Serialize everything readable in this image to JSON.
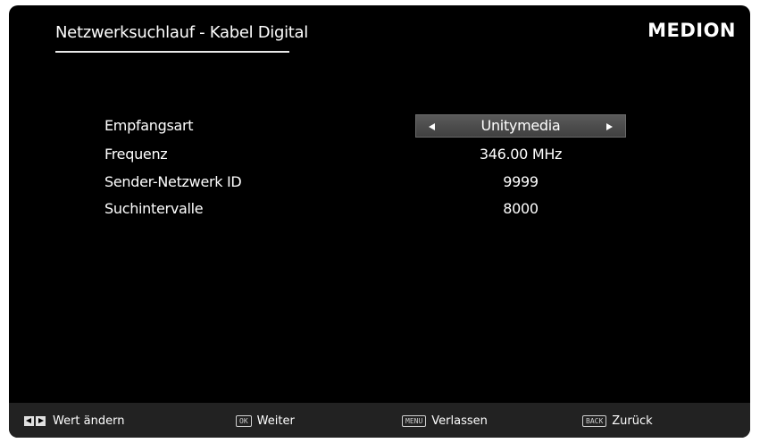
{
  "header": {
    "title": "Netzwerksuchlauf - Kabel Digital",
    "brand": "MEDION"
  },
  "settings": [
    {
      "label": "Empfangsart",
      "value": "Unitymedia"
    },
    {
      "label": "Frequenz",
      "value": "346.00 MHz"
    },
    {
      "label": "Sender-Netzwerk ID",
      "value": "9999"
    },
    {
      "label": "Suchintervalle",
      "value": "8000"
    }
  ],
  "footer": {
    "change": {
      "keys_icon": "left-right-arrow-keys-icon",
      "label": "Wert ändern"
    },
    "next": {
      "key": "OK",
      "label": "Weiter"
    },
    "exit": {
      "key": "MENU",
      "label": "Verlassen"
    },
    "back": {
      "key": "BACK",
      "label": "Zurück"
    }
  },
  "colors": {
    "background": "#000000",
    "footer": "#222222",
    "selector": "#4a4a4a",
    "text": "#ffffff"
  }
}
